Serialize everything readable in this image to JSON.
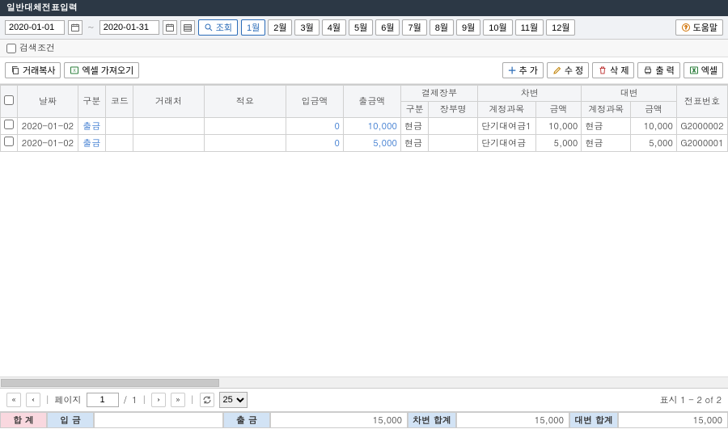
{
  "title": "일반대체전표입력",
  "date_from": "2020-01-01",
  "date_to": "2020-01-31",
  "tilde": "~",
  "btn_search": "조회",
  "months": [
    "1월",
    "2월",
    "3월",
    "4월",
    "5월",
    "6월",
    "7월",
    "8월",
    "9월",
    "10월",
    "11월",
    "12월"
  ],
  "active_month_index": 0,
  "btn_help": "도움말",
  "cond_label": "검색조건",
  "btn_copy": "거래복사",
  "btn_excel_import": "엑셀 가져오기",
  "btn_add": "추 가",
  "btn_edit": "수 정",
  "btn_delete": "삭 제",
  "btn_print": "출 력",
  "btn_excel": "엑셀",
  "headers": {
    "date": "날짜",
    "type": "구분",
    "code": "코드",
    "vendor": "거래처",
    "desc": "적요",
    "in_amt": "입금액",
    "out_amt": "출금액",
    "pay_group": "결제장부",
    "pay_type": "구분",
    "pay_book": "장부명",
    "debit_group": "차변",
    "debit_acct": "계정과목",
    "debit_amt": "금액",
    "credit_group": "대변",
    "credit_acct": "계정과목",
    "credit_amt": "금액",
    "slipno": "전표번호"
  },
  "rows": [
    {
      "date": "2020-01-02",
      "type": "출금",
      "code": "",
      "vendor": "",
      "desc": "",
      "in_amt": "0",
      "out_amt": "10,000",
      "pay_type": "현금",
      "pay_book": "",
      "debit_acct": "단기대여금1",
      "debit_amt": "10,000",
      "credit_acct": "현금",
      "credit_amt": "10,000",
      "slipno": "G2000002"
    },
    {
      "date": "2020-01-02",
      "type": "출금",
      "code": "",
      "vendor": "",
      "desc": "",
      "in_amt": "0",
      "out_amt": "5,000",
      "pay_type": "현금",
      "pay_book": "",
      "debit_acct": "단기대여금",
      "debit_amt": "5,000",
      "credit_acct": "현금",
      "credit_amt": "5,000",
      "slipno": "G2000001"
    }
  ],
  "pager": {
    "label": "페이지",
    "page": "1",
    "total": "1",
    "slash": "/",
    "page_size": "25",
    "display": "표시 1 - 2 of 2"
  },
  "summary": {
    "total_lbl": "합 계",
    "in_lbl": "입 금",
    "in_val": "",
    "out_lbl": "출 금",
    "out_val": "15,000",
    "debit_lbl": "차변 합계",
    "debit_val": "15,000",
    "credit_lbl": "대변 합계",
    "credit_val": "15,000"
  }
}
